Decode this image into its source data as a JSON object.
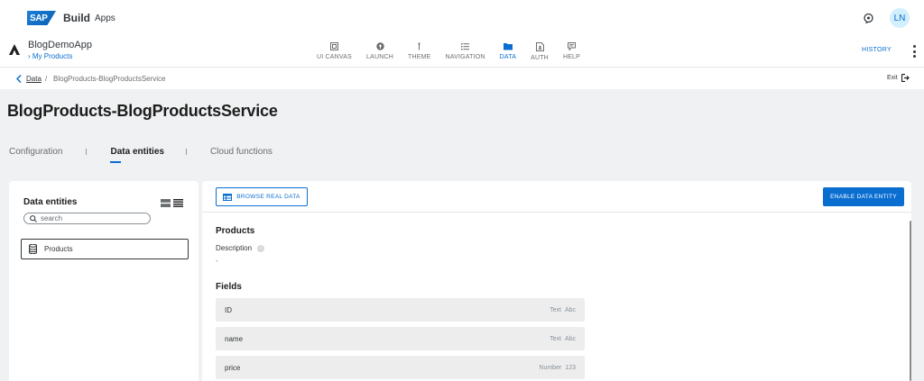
{
  "shell": {
    "logo_text": "SAP",
    "brand": "Build",
    "brand_sub": "Apps",
    "avatar": "LN",
    "notification_icon": "bell-sync-icon"
  },
  "app": {
    "name": "BlogDemoApp",
    "link": "My Products",
    "nav": [
      {
        "label": "UI CANVAS",
        "icon": "canvas-icon",
        "active": false
      },
      {
        "label": "LAUNCH",
        "icon": "launch-icon",
        "active": false
      },
      {
        "label": "THEME",
        "icon": "theme-icon",
        "active": false
      },
      {
        "label": "NAVIGATION",
        "icon": "navigation-icon",
        "active": false
      },
      {
        "label": "DATA",
        "icon": "folder-icon",
        "active": true
      },
      {
        "label": "AUTH",
        "icon": "auth-icon",
        "active": false
      },
      {
        "label": "HELP",
        "icon": "help-icon",
        "active": false
      }
    ],
    "history": "HISTORY"
  },
  "breadcrumb": {
    "link": "Data",
    "separator": "/",
    "current": "BlogProducts-BlogProductsService",
    "exit": "Exit"
  },
  "page": {
    "title": "BlogProducts-BlogProductsService",
    "tabs": [
      {
        "label": "Configuration",
        "active": false
      },
      {
        "label": "Data entities",
        "active": true
      },
      {
        "label": "Cloud functions",
        "active": false
      }
    ]
  },
  "left_panel": {
    "title": "Data entities",
    "search_placeholder": "search",
    "entities": [
      "Products"
    ]
  },
  "right_panel": {
    "browse_button": "BROWSE REAL DATA",
    "enable_button": "ENABLE DATA ENTITY",
    "entity_title": "Products",
    "description_label": "Description",
    "description_value": "-",
    "fields_title": "Fields",
    "fields": [
      {
        "name": "ID",
        "type": "Text",
        "glyph": "Abc"
      },
      {
        "name": "name",
        "type": "Text",
        "glyph": "Abc"
      },
      {
        "name": "price",
        "type": "Number",
        "glyph": "123"
      }
    ]
  },
  "colors": {
    "accent": "#0a6ed1",
    "background": "#f0f1f2",
    "field_row": "#ededed"
  }
}
